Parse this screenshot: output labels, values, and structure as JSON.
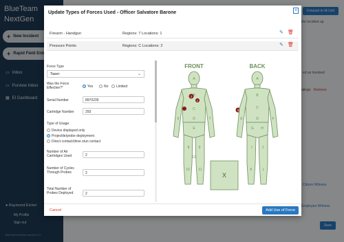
{
  "sidebar": {
    "brand_line1": "BlueTeam",
    "brand_line2": "NextGen",
    "new_incident": "New Incident",
    "rapid_field_entry": "Rapid Field Entry",
    "items": [
      {
        "label": "Inbox"
      },
      {
        "label": "Purview Inbox"
      },
      {
        "label": "EI Dashboard"
      }
    ],
    "user_name": "Raymond Eicher",
    "my_profile": "My Profile",
    "sign_out": "Sign out",
    "footer": "BlueTeam NextGen version 4.1.0"
  },
  "background": {
    "forward_button": "Forward to IA Unit",
    "text_incident_up": "the incident up",
    "text_ed_as_involved": "ed as involved",
    "text_ratings": "atings",
    "text_remove": "Remove",
    "text_citizen_witness": "Citizen Witness",
    "text_employee_witness": "Employee Witness",
    "save_button": "Save"
  },
  "modal": {
    "title": "Update Types of Forces Used - Officer Salvatore Barone",
    "rows": [
      {
        "type": "Firearm - Handgun",
        "regions": "Regions: 7 Locations: 1"
      },
      {
        "type": "Pressure Points",
        "regions": "Regions: C Locations: 2"
      }
    ],
    "form": {
      "force_type_label": "Force Type",
      "force_type_value": "Taser",
      "effective_label": "Was the Force Effective?",
      "required_mark": "*",
      "effective_options": [
        "Yes",
        "No",
        "Limited"
      ],
      "effective_selected": "Yes",
      "serial_label": "Serial Number",
      "serial_value": "8970239",
      "cartridge_label": "Cartridge Number",
      "cartridge_value": "293",
      "usage_label": "Type of Usage",
      "usage_options": [
        "Device displayed only",
        "Projectile/probe deployment",
        "Direct contact/drive stun contact"
      ],
      "usage_selected": "Projectile/probe deployment",
      "air_cartridges_label": "Number of Air Cartridges Used",
      "air_cartridges_value": "2",
      "cycles_label": "Number of Cycles Through Probes",
      "cycles_value": "2",
      "probes_label": "Total Number of Probes Deployed",
      "probes_value": "2"
    },
    "diagram": {
      "front_label": "FRONT",
      "back_label": "BACK",
      "x_label": "X",
      "front_regions": [
        "A",
        "B",
        "C",
        "D",
        "E",
        "6",
        "7",
        "8",
        "9",
        "10",
        "11",
        "12"
      ],
      "back_regions": [
        "A",
        "B",
        "C",
        "D",
        "E",
        "F",
        "G",
        "H",
        "I",
        "J",
        "K",
        "L"
      ],
      "markers": [
        "1",
        "2",
        "3"
      ]
    },
    "cancel": "Cancel",
    "add_button": "Add Use of Force"
  }
}
